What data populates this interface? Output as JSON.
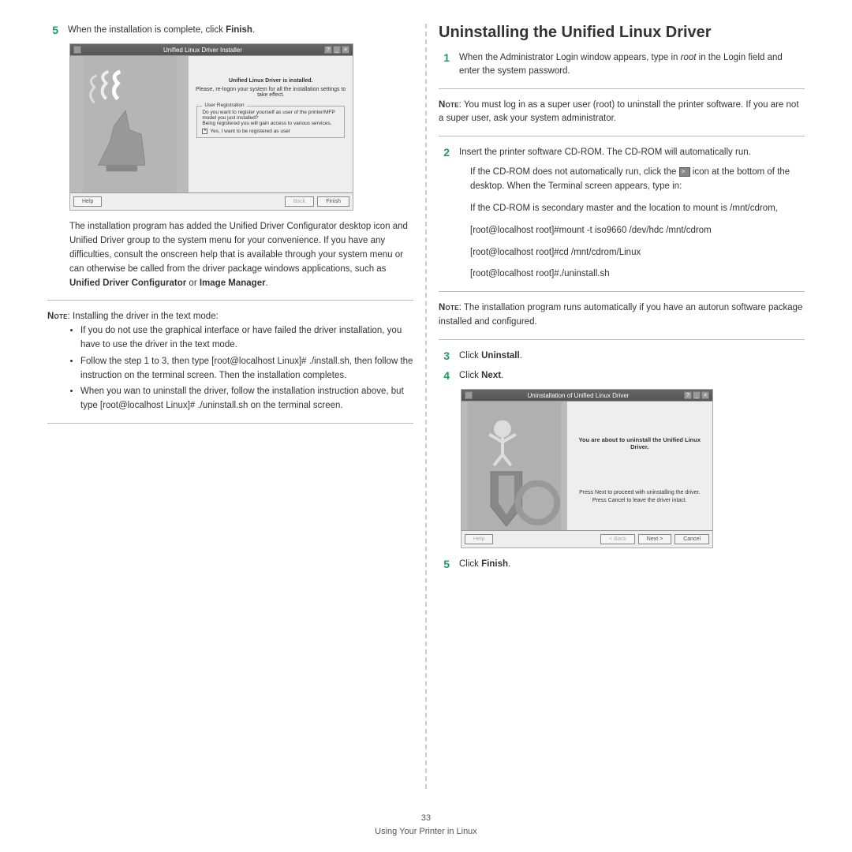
{
  "left": {
    "step5_num": "5",
    "step5_pre": "When the installation is complete, click ",
    "step5_bold": "Finish",
    "step5_post": ".",
    "ss_title": "Unified Linux Driver Installer",
    "ss_hdr": "Unified Linux Driver is installed.",
    "ss_sub": "Please, re-logon your system for all the installation settings to take effect.",
    "ss_group_leg": "User Registration",
    "ss_group_body": "Do you want to register yourself as user of the printer/MFP model you just installed?\nBeing registered you will gain access to various services.",
    "ss_check_label": "Yes, I want to be registered as user",
    "ss_help": "Help",
    "ss_back": "Back",
    "ss_finish": "Finish",
    "para1a": "The installation program has added the Unified Driver Configurator desktop icon and  Unified Driver group to the system menu for your convenience. If you have any difficulties, consult the onscreen help that is available through your system menu or can otherwise be called from the driver package windows applications, such as ",
    "para1b": "Unified Driver Configurator",
    "para1c": " or ",
    "para1d": "Image Manager",
    "para1e": ".",
    "note_label": "Note",
    "note1_text": ": Installing the driver in the text mode:",
    "b1": "If you do not use the graphical interface or have failed the driver installation, you have to use the driver in the text mode.",
    "b2": "Follow the step 1 to 3, then type [root@localhost Linux]# ./install.sh, then follow the instruction on the terminal screen. Then the installation completes.",
    "b3": "When you wan to uninstall the driver, follow the installation instruction above, but type [root@localhost Linux]# ./uninstall.sh on the terminal screen."
  },
  "right": {
    "heading": "Uninstalling the Unified Linux Driver",
    "s1_num": "1",
    "s1_a": "When the Administrator Login window appears, type in ",
    "s1_b": "root",
    "s1_c": " in the Login field and enter the system password.",
    "note_label": "Note",
    "note1": ": You must log in as a super user (root) to uninstall the printer software. If you are not a super user, ask your system administrator.",
    "s2_num": "2",
    "s2_text": "Insert the printer software CD-ROM. The CD-ROM will automatically run.",
    "sub1a": "If the CD-ROM does not automatically run, click the ",
    "sub1b": " icon at the bottom of the desktop. When the Terminal screen appears, type in:",
    "sub2": "If the CD-ROM is secondary master and the location to mount is /mnt/cdrom,",
    "sub3": "[root@localhost root]#mount -t iso9660 /dev/hdc /mnt/cdrom",
    "sub4": "[root@localhost root]#cd /mnt/cdrom/Linux",
    "sub5": "[root@localhost root]#./uninstall.sh",
    "note2": ": The installation program runs automatically if you have an autorun software package installed and configured.",
    "s3_num": "3",
    "s3_a": "Click ",
    "s3_b": "Uninstall",
    "s3_c": ".",
    "s4_num": "4",
    "s4_a": "Click ",
    "s4_b": "Next",
    "s4_c": ".",
    "ss2_title": "Uninstallation of Unified Linux Driver",
    "ss2_msg": "You are about to uninstall the Unified Linux Driver.",
    "ss2_l1": "Press Next to proceed with uninstalling the driver.",
    "ss2_l2": "Press Cancel to leave the driver intact.",
    "ss2_help": "Help",
    "ss2_back": "< Back",
    "ss2_next": "Next >",
    "ss2_cancel": "Cancel",
    "s5_num": "5",
    "s5_a": "Click ",
    "s5_b": "Finish",
    "s5_c": "."
  },
  "footer": {
    "page_num": "33",
    "caption": "Using Your Printer in Linux"
  }
}
